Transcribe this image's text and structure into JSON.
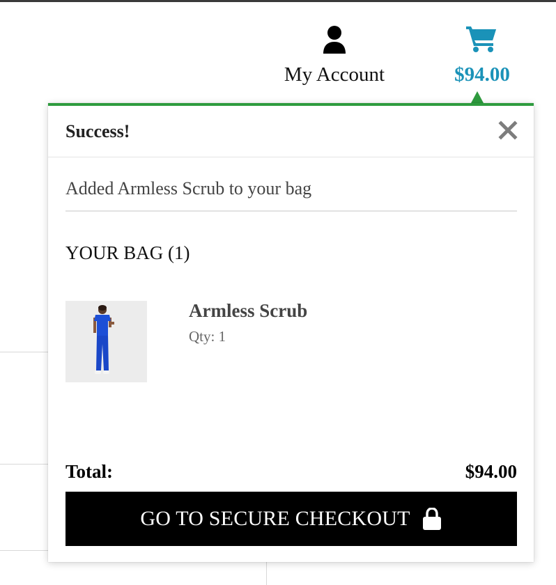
{
  "header": {
    "account_label": "My Account",
    "account_icon": "person-icon",
    "cart_total": "$94.00",
    "cart_icon": "shopping-cart-icon",
    "accent_color": "#1a92b8"
  },
  "notification": {
    "title": "Success!",
    "message": "Added Armless Scrub to your bag",
    "close_icon": "close-icon",
    "status_color": "#2e9b3e"
  },
  "bag": {
    "title": "YOUR BAG (1)",
    "items": [
      {
        "name": "Armless Scrub",
        "qty_label": "Qty: 1",
        "image": "product-photo-blue-scrub"
      }
    ],
    "total_label": "Total:",
    "total_value": "$94.00",
    "checkout_label": "GO TO SECURE CHECKOUT",
    "checkout_icon": "lock-icon"
  }
}
